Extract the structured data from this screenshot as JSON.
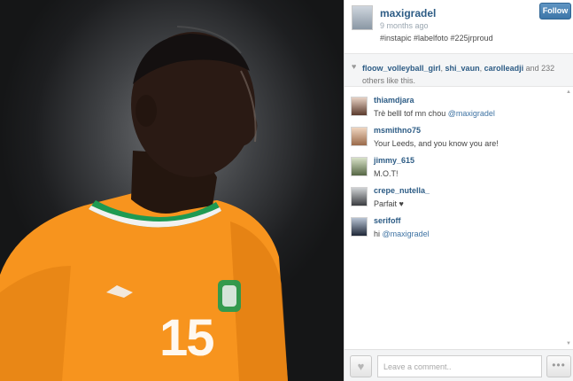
{
  "post": {
    "username": "maxigradel",
    "time_ago": "9 months ago",
    "caption": "#instapic #labelfoto #225jrproud",
    "follow_label": "Follow"
  },
  "photo": {
    "jersey_number": "15",
    "colors": {
      "jersey": "#f7941e",
      "background": "#2b2c2e",
      "skin": "#2a1a14"
    }
  },
  "likes": {
    "user1": "floow_volleyball_girl",
    "sep1": ", ",
    "user2": "shi_vaun",
    "sep2": ", ",
    "user3": "carolleadji",
    "rest": " and 232 others like this."
  },
  "comments": [
    {
      "user": "thiamdjara",
      "text": "Trè belll tof mn chou ",
      "mention": "@maxigradel"
    },
    {
      "user": "msmithno75",
      "text": "Your Leeds, and you know you are!",
      "mention": ""
    },
    {
      "user": "jimmy_615",
      "text": "M.O.T!",
      "mention": ""
    },
    {
      "user": "crepe_nutella_",
      "text": "Parfait ♥",
      "mention": ""
    },
    {
      "user": "serifoff",
      "text": "hi ",
      "mention": "@maxigradel"
    }
  ],
  "footer": {
    "comment_placeholder": "Leave a comment..",
    "like_icon": "heart-icon",
    "more_icon": "ellipsis-icon"
  },
  "icons": {
    "heart": "♥",
    "more": "•••",
    "scroll_up": "▲",
    "scroll_down": "▼"
  }
}
